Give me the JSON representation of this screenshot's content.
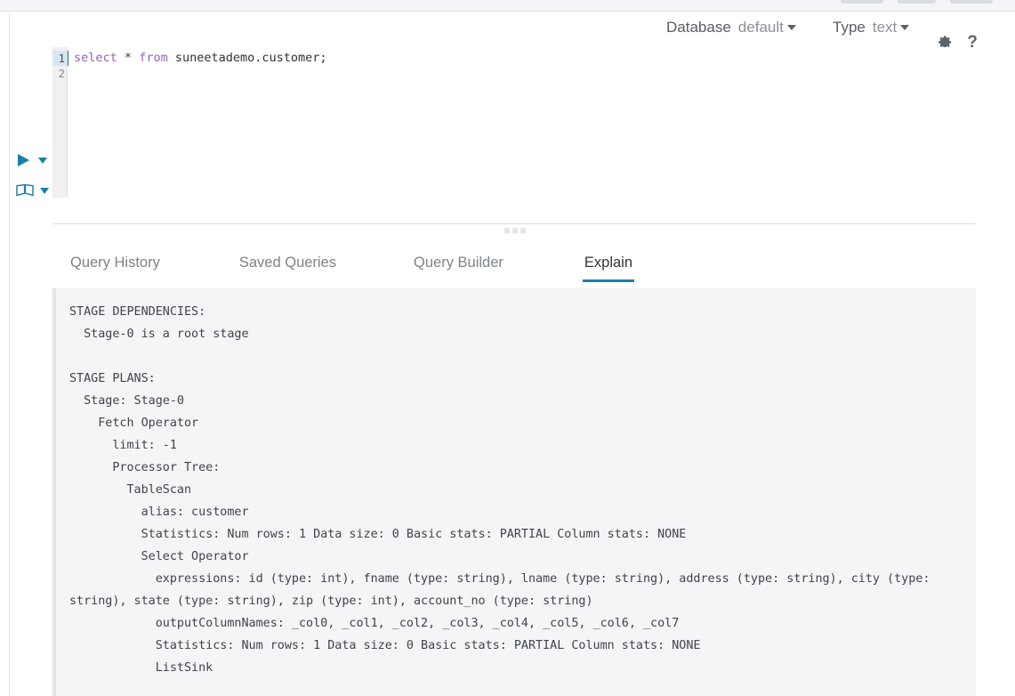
{
  "header": {
    "database_label": "Database",
    "database_value": "default",
    "type_label": "Type",
    "type_value": "text",
    "settings_icon": "gear-icon",
    "help_icon": "question-mark-icon",
    "help_glyph": "?"
  },
  "side_actions": {
    "run": {
      "icon": "play-triangle-icon",
      "name": "execute-query-button"
    },
    "explain": {
      "icon": "open-book-icon",
      "name": "explain-query-button"
    }
  },
  "editor": {
    "line_numbers": [
      "1",
      "2"
    ],
    "active_line": "1",
    "query_text": "select * from suneetademo.customer;",
    "tokens": {
      "kw_select": "select",
      "star": "*",
      "kw_from": "from",
      "table": "suneetademo.customer;"
    }
  },
  "tabs": [
    {
      "label": "Query History",
      "active": false
    },
    {
      "label": "Saved Queries",
      "active": false
    },
    {
      "label": "Query Builder",
      "active": false
    },
    {
      "label": "Explain",
      "active": true
    }
  ],
  "explain_output": "STAGE DEPENDENCIES:\n  Stage-0 is a root stage\n\nSTAGE PLANS:\n  Stage: Stage-0\n    Fetch Operator\n      limit: -1\n      Processor Tree:\n        TableScan\n          alias: customer\n          Statistics: Num rows: 1 Data size: 0 Basic stats: PARTIAL Column stats: NONE\n          Select Operator\n            expressions: id (type: int), fname (type: string), lname (type: string), address (type: string), city (type: string), state (type: string), zip (type: int), account_no (type: string)\n            outputColumnNames: _col0, _col1, _col2, _col3, _col4, _col5, _col6, _col7\n            Statistics: Num rows: 1 Data size: 0 Basic stats: PARTIAL Column stats: NONE\n            ListSink",
  "colors": {
    "accent": "#1a7fa8",
    "panel_bg": "#f4f5f7",
    "keyword": "#9b60b4",
    "text": "#3f444b"
  }
}
